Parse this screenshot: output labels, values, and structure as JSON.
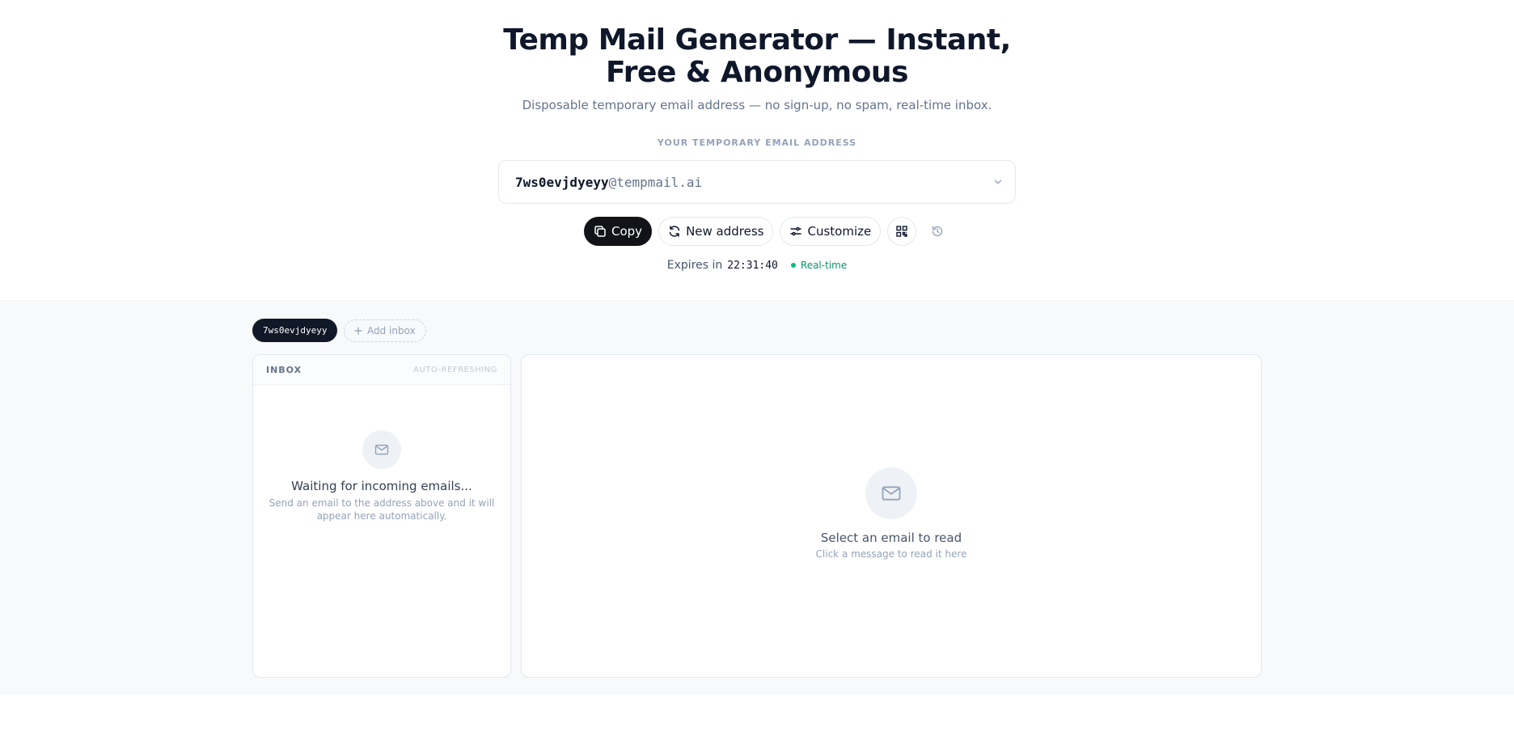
{
  "hero": {
    "title": "Temp Mail Generator — Instant, Free & Anonymous",
    "subtitle": "Disposable temporary email address — no sign-up, no spam, real-time inbox.",
    "address_label": "YOUR TEMPORARY EMAIL ADDRESS",
    "address_local": "7ws0evjdyeyy",
    "address_domain": "@tempmail.ai"
  },
  "actions": {
    "copy_label": "Copy",
    "new_address_label": "New address",
    "customize_label": "Customize"
  },
  "status": {
    "expires_label": "Expires in",
    "timer": "22:31:40",
    "realtime_label": "Real-time"
  },
  "inbox_tabs": {
    "active": "7ws0evjdyeyy",
    "add_label": "Add inbox"
  },
  "inbox": {
    "title": "INBOX",
    "refresh_status": "AUTO-REFRESHING",
    "empty_title": "Waiting for incoming emails...",
    "empty_sub": "Send an email to the address above and it will appear here automatically."
  },
  "reader": {
    "empty_title": "Select an email to read",
    "empty_sub": "Click a message to read it here"
  },
  "colors": {
    "primary_dark": "#111318",
    "realtime_green": "#10b981",
    "muted": "#94a3b8"
  },
  "icons": [
    "copy-icon",
    "refresh-icon",
    "sliders-icon",
    "qr-code-icon",
    "history-icon",
    "chevron-down-icon",
    "plus-icon",
    "mail-icon"
  ]
}
